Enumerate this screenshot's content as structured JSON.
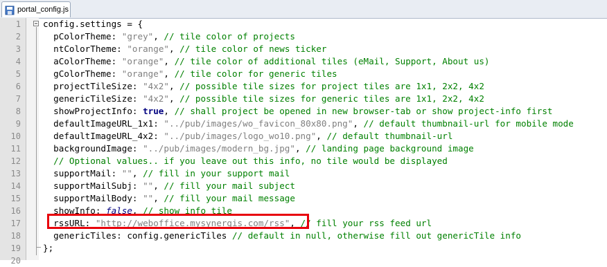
{
  "editor": {
    "tab": {
      "label": "portal_config.js"
    },
    "colors": {
      "comment": "#008000",
      "string": "#808080",
      "keyword": "#000080",
      "highlight": "#e8000b"
    },
    "lines": [
      {
        "n": "1",
        "tokens": [
          {
            "t": "d",
            "v": "config.settings = {"
          }
        ]
      },
      {
        "n": "2",
        "tokens": [
          {
            "t": "d",
            "v": "  pColorTheme: "
          },
          {
            "t": "s",
            "v": "\"grey\""
          },
          {
            "t": "d",
            "v": ", "
          },
          {
            "t": "c",
            "v": "// tile color of projects"
          }
        ]
      },
      {
        "n": "3",
        "tokens": [
          {
            "t": "d",
            "v": "  ntColorTheme: "
          },
          {
            "t": "s",
            "v": "\"orange\""
          },
          {
            "t": "d",
            "v": ", "
          },
          {
            "t": "c",
            "v": "// tile color of news ticker"
          }
        ]
      },
      {
        "n": "4",
        "tokens": [
          {
            "t": "d",
            "v": "  aColorTheme: "
          },
          {
            "t": "s",
            "v": "\"orange\""
          },
          {
            "t": "d",
            "v": ", "
          },
          {
            "t": "c",
            "v": "// tile color of additional tiles (eMail, Support, About us)"
          }
        ]
      },
      {
        "n": "5",
        "tokens": [
          {
            "t": "d",
            "v": "  gColorTheme: "
          },
          {
            "t": "s",
            "v": "\"orange\""
          },
          {
            "t": "d",
            "v": ", "
          },
          {
            "t": "c",
            "v": "// tile color for generic tiles"
          }
        ]
      },
      {
        "n": "6",
        "tokens": [
          {
            "t": "d",
            "v": "  projectTileSize: "
          },
          {
            "t": "s",
            "v": "\"4x2\""
          },
          {
            "t": "d",
            "v": ", "
          },
          {
            "t": "c",
            "v": "// possible tile sizes for project tiles are 1x1, 2x2, 4x2"
          }
        ]
      },
      {
        "n": "7",
        "tokens": [
          {
            "t": "d",
            "v": "  genericTileSize: "
          },
          {
            "t": "s",
            "v": "\"4x2\""
          },
          {
            "t": "d",
            "v": ", "
          },
          {
            "t": "c",
            "v": "// possible tile sizes for generic tiles are 1x1, 2x2, 4x2"
          }
        ]
      },
      {
        "n": "8",
        "tokens": [
          {
            "t": "d",
            "v": "  showProjectInfo: "
          },
          {
            "t": "k",
            "v": "true"
          },
          {
            "t": "d",
            "v": ", "
          },
          {
            "t": "c",
            "v": "// shall project be opened in new browser-tab or show project-info first"
          }
        ]
      },
      {
        "n": "9",
        "tokens": [
          {
            "t": "d",
            "v": "  defaultImageURL_1x1: "
          },
          {
            "t": "s",
            "v": "\"../pub/images/wo_favicon_80x80.png\""
          },
          {
            "t": "d",
            "v": ", "
          },
          {
            "t": "c",
            "v": "// default thumbnail-url for mobile mode"
          }
        ]
      },
      {
        "n": "10",
        "tokens": [
          {
            "t": "d",
            "v": "  defaultImageURL_4x2: "
          },
          {
            "t": "s",
            "v": "\"../pub/images/logo_wo10.png\""
          },
          {
            "t": "d",
            "v": ", "
          },
          {
            "t": "c",
            "v": "// default thumbnail-url"
          }
        ]
      },
      {
        "n": "11",
        "tokens": [
          {
            "t": "d",
            "v": "  backgroundImage: "
          },
          {
            "t": "s",
            "v": "\"../pub/images/modern_bg.jpg\""
          },
          {
            "t": "d",
            "v": ", "
          },
          {
            "t": "c",
            "v": "// landing page background image"
          }
        ]
      },
      {
        "n": "12",
        "tokens": [
          {
            "t": "c",
            "v": "  // Optional values.. if you leave out this info, no tile would be displayed"
          }
        ]
      },
      {
        "n": "13",
        "tokens": [
          {
            "t": "d",
            "v": "  supportMail: "
          },
          {
            "t": "s",
            "v": "\"\""
          },
          {
            "t": "d",
            "v": ", "
          },
          {
            "t": "c",
            "v": "// fill in your support mail"
          }
        ]
      },
      {
        "n": "14",
        "tokens": [
          {
            "t": "d",
            "v": "  supportMailSubj: "
          },
          {
            "t": "s",
            "v": "\"\""
          },
          {
            "t": "d",
            "v": ", "
          },
          {
            "t": "c",
            "v": "// fill your mail subject"
          }
        ]
      },
      {
        "n": "15",
        "tokens": [
          {
            "t": "d",
            "v": "  supportMailBody: "
          },
          {
            "t": "s",
            "v": "\"\""
          },
          {
            "t": "d",
            "v": ", "
          },
          {
            "t": "c",
            "v": "// fill your mail message"
          }
        ]
      },
      {
        "n": "16",
        "tokens": [
          {
            "t": "d",
            "v": "  showInfo: "
          },
          {
            "t": "ki",
            "v": "false"
          },
          {
            "t": "d",
            "v": ", "
          },
          {
            "t": "c",
            "v": "// show info tile"
          }
        ]
      },
      {
        "n": "17",
        "tokens": [
          {
            "t": "d",
            "v": "  rssURL: "
          },
          {
            "t": "s",
            "v": "\"http://weboffice.mysynergis.com/rss\""
          },
          {
            "t": "d",
            "v": ", "
          },
          {
            "t": "c",
            "v": "// fill your rss feed url"
          }
        ]
      },
      {
        "n": "18",
        "tokens": [
          {
            "t": "d",
            "v": "  genericTiles: config.genericTiles "
          },
          {
            "t": "c",
            "v": "// default in null, otherwise fill out genericTile info"
          }
        ]
      },
      {
        "n": "19",
        "tokens": [
          {
            "t": "d",
            "v": "};"
          }
        ]
      },
      {
        "n": "20",
        "tokens": []
      }
    ]
  }
}
